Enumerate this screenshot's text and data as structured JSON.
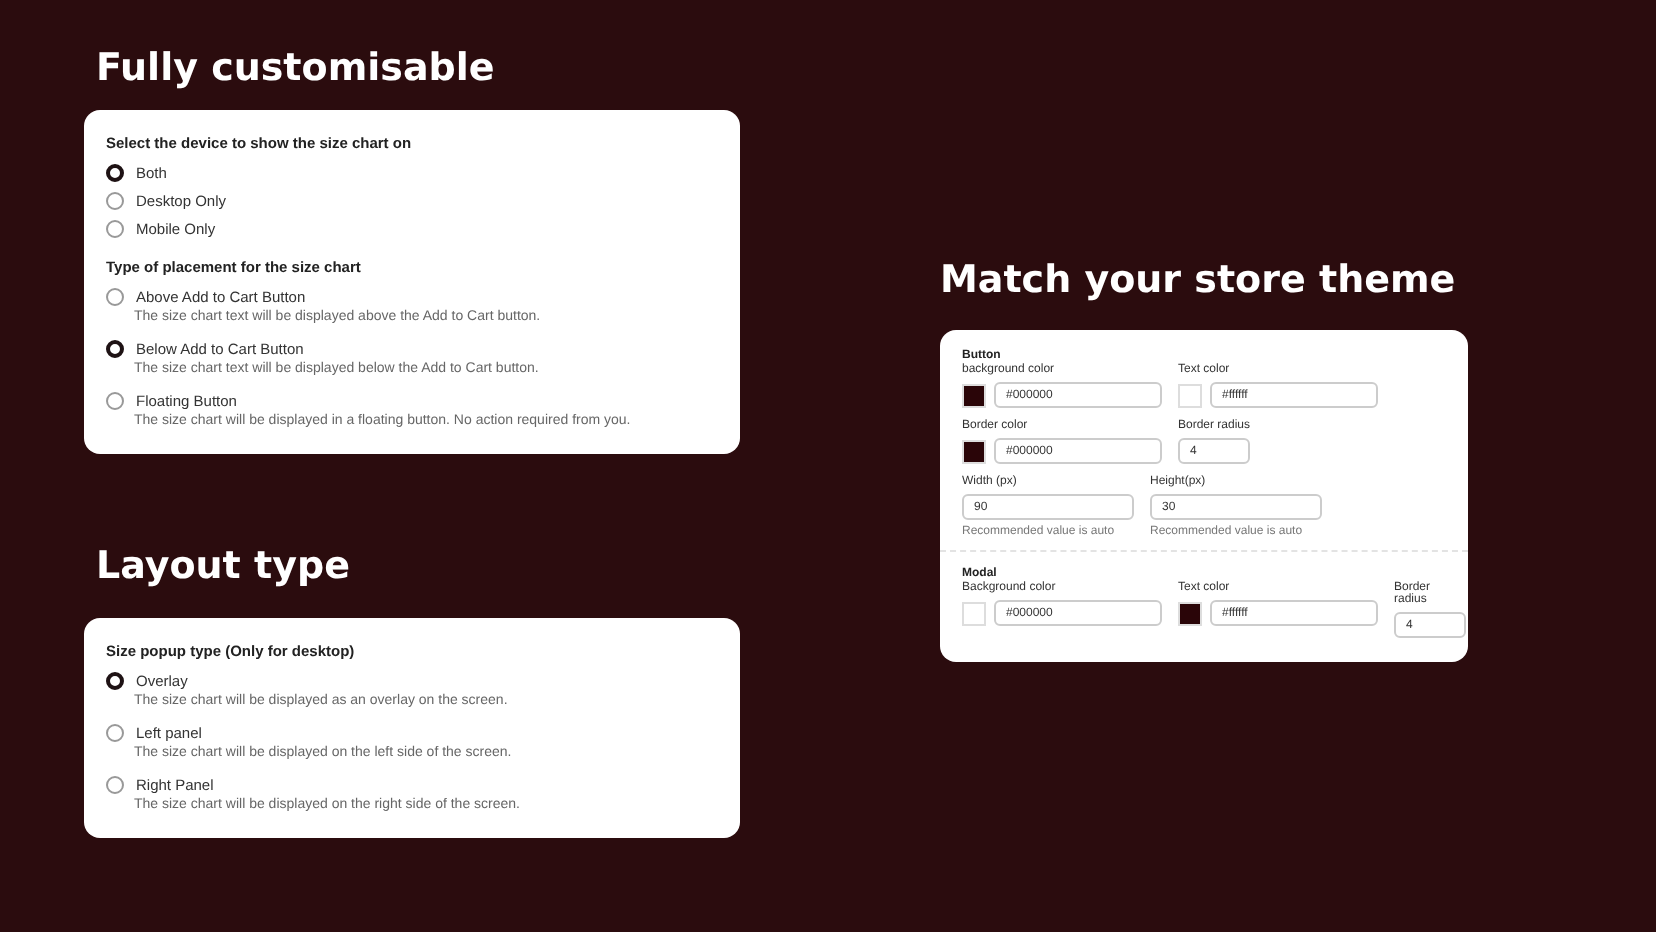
{
  "headings": {
    "customisable": "Fully customisable",
    "layout": "Layout type",
    "theme": "Match your store theme"
  },
  "placement_card": {
    "groups": [
      {
        "title": "Select the device to show the size chart on",
        "options": [
          {
            "label": "Both",
            "selected": true
          },
          {
            "label": "Desktop Only",
            "selected": false
          },
          {
            "label": "Mobile Only",
            "selected": false
          }
        ]
      },
      {
        "title": "Type of placement for the size chart",
        "options": [
          {
            "label": "Above Add to Cart Button",
            "description": "The size chart text will be displayed above the Add to Cart button.",
            "selected": false
          },
          {
            "label": "Below Add to Cart Button",
            "description": "The size chart text will be displayed below the Add to Cart button.",
            "selected": true
          },
          {
            "label": "Floating Button",
            "description": "The size chart will be displayed in a floating button. No action required from you.",
            "selected": false
          }
        ]
      }
    ]
  },
  "layout_card": {
    "groups": [
      {
        "title": "Size popup type (Only for desktop)",
        "options": [
          {
            "label": "Overlay",
            "description": "The size chart will be displayed as an overlay on the screen.",
            "selected": true
          },
          {
            "label": "Left panel",
            "description": "The size chart will be displayed on the left side of the screen.",
            "selected": false
          },
          {
            "label": "Right Panel",
            "description": "The size chart will be displayed on the right side of the screen.",
            "selected": false
          }
        ]
      }
    ]
  },
  "theme_card": {
    "sections": [
      {
        "title": "Button",
        "rows": [
          [
            {
              "kind": "color",
              "label": "background color",
              "color": "#2a0508",
              "value": "#000000"
            },
            {
              "kind": "color",
              "label": "Text color",
              "color": "#ffffff",
              "value": "#ffffff"
            }
          ],
          [
            {
              "kind": "color",
              "label": "Border color",
              "color": "#2a0508",
              "value": "#000000"
            },
            {
              "kind": "short",
              "label": "Border radius",
              "value": "4"
            }
          ],
          [
            {
              "kind": "number",
              "label": "Width (px)",
              "value": "90",
              "hint": "Recommended value is auto"
            },
            {
              "kind": "number",
              "label": "Height(px)",
              "value": "30",
              "hint": "Recommended value is auto"
            }
          ]
        ]
      },
      {
        "title": "Modal",
        "rows": [
          [
            {
              "kind": "color",
              "label": "Background color",
              "color": "#ffffff",
              "value": "#000000"
            },
            {
              "kind": "color",
              "label": "Text color",
              "color": "#2a0508",
              "value": "#ffffff"
            },
            {
              "kind": "short",
              "label": "Border radius",
              "value": "4"
            }
          ]
        ]
      }
    ]
  }
}
